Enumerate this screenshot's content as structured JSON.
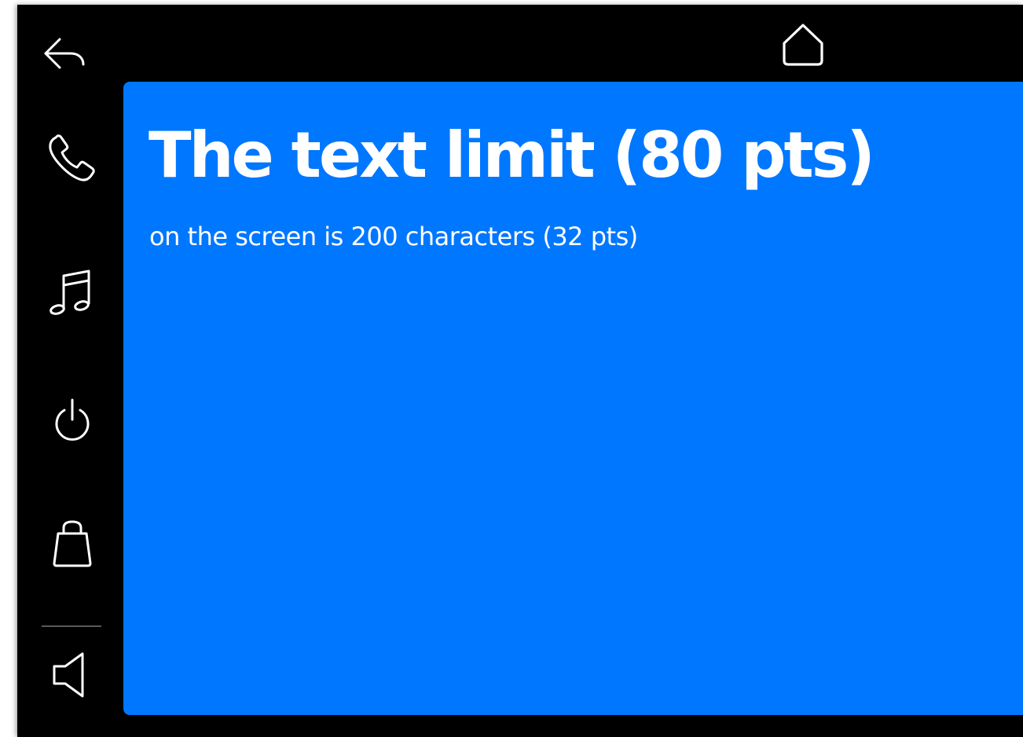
{
  "top_bar": {
    "back_icon": "back-arrow-icon",
    "home_icon": "home-icon"
  },
  "side_nav": {
    "items": [
      {
        "icon": "phone-icon"
      },
      {
        "icon": "music-note-icon"
      },
      {
        "icon": "power-icon"
      },
      {
        "icon": "shopping-bag-icon"
      },
      {
        "icon": "volume-speaker-icon"
      }
    ]
  },
  "content": {
    "title": "The text limit (80 pts)",
    "subtitle": "on the screen is 200 characters (32 pts)"
  },
  "colors": {
    "background": "#000000",
    "panel": "#0077ff",
    "text": "#ffffff",
    "divider": "#5a5a5a"
  }
}
